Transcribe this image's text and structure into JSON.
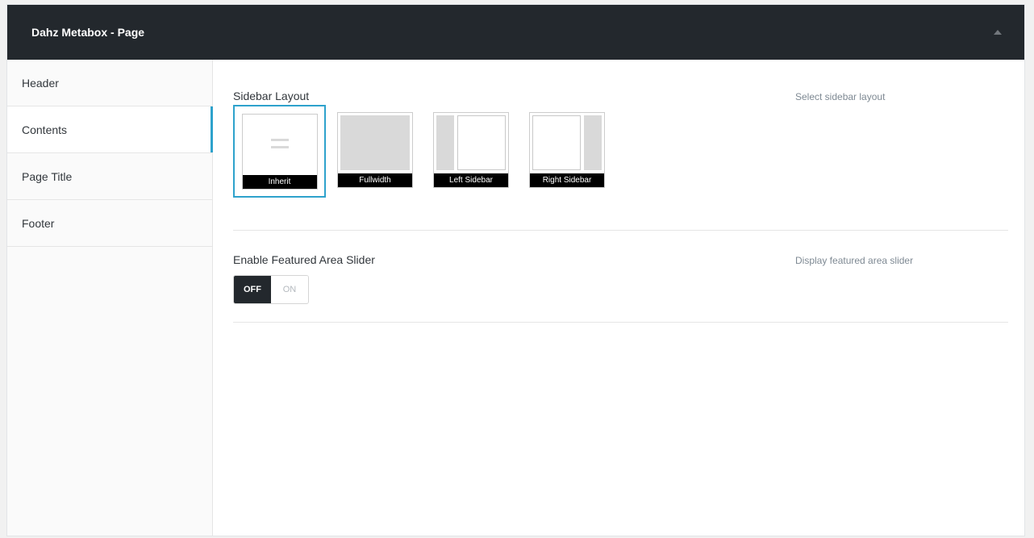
{
  "metabox": {
    "title": "Dahz Metabox - Page",
    "toggle_icon": "triangle-up-icon"
  },
  "tabs": [
    {
      "label": "Header",
      "active": false
    },
    {
      "label": "Contents",
      "active": true
    },
    {
      "label": "Page Title",
      "active": false
    },
    {
      "label": "Footer",
      "active": false
    }
  ],
  "sidebar_layout": {
    "label": "Sidebar Layout",
    "description": "Select sidebar layout",
    "selected": "Inherit",
    "options": [
      {
        "caption": "Inherit",
        "icon": "equals-icon"
      },
      {
        "caption": "Fullwidth",
        "icon": "fullwidth-layout-icon"
      },
      {
        "caption": "Left Sidebar",
        "icon": "left-sidebar-layout-icon"
      },
      {
        "caption": "Right Sidebar",
        "icon": "right-sidebar-layout-icon"
      }
    ]
  },
  "featured_slider": {
    "label": "Enable Featured Area Slider",
    "description": "Display featured area slider",
    "off_label": "OFF",
    "on_label": "ON",
    "value": "OFF"
  },
  "colors": {
    "header_bg": "#23282d",
    "accent": "#2ea2cc"
  }
}
